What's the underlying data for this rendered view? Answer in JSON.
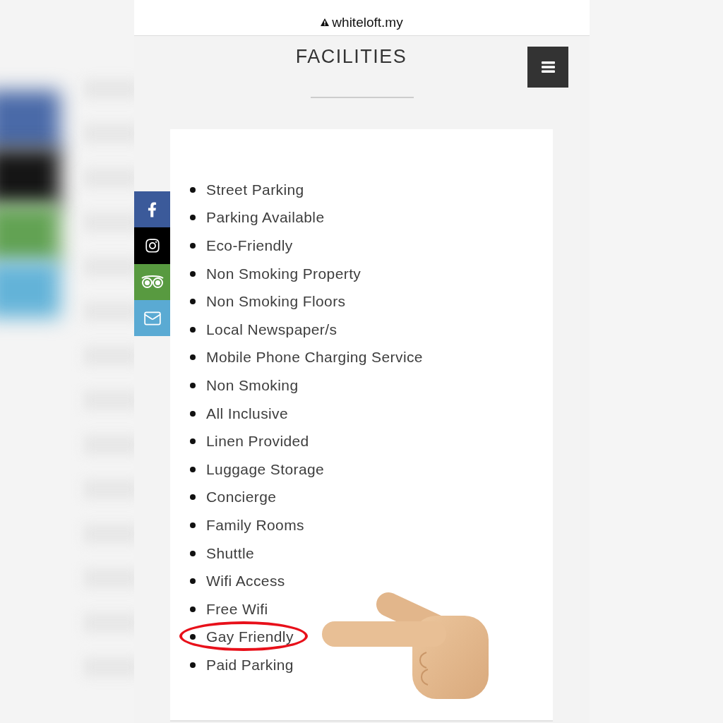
{
  "address_bar": {
    "insecure": true,
    "url": "whiteloft.my"
  },
  "page": {
    "title": "FACILITIES"
  },
  "social_links": [
    {
      "kind": "facebook",
      "color": "#3b5a9a"
    },
    {
      "kind": "instagram",
      "color": "#000000"
    },
    {
      "kind": "tripadvisor",
      "color": "#589a40"
    },
    {
      "kind": "email",
      "color": "#5aaad3"
    }
  ],
  "facilities": [
    {
      "label": "Street Parking",
      "highlighted": false
    },
    {
      "label": "Parking Available",
      "highlighted": false
    },
    {
      "label": "Eco-Friendly",
      "highlighted": false
    },
    {
      "label": "Non Smoking Property",
      "highlighted": false
    },
    {
      "label": "Non Smoking Floors",
      "highlighted": false
    },
    {
      "label": "Local Newspaper/s",
      "highlighted": false
    },
    {
      "label": "Mobile Phone Charging Service",
      "highlighted": false
    },
    {
      "label": "Non Smoking",
      "highlighted": false
    },
    {
      "label": "All Inclusive",
      "highlighted": false
    },
    {
      "label": "Linen Provided",
      "highlighted": false
    },
    {
      "label": "Luggage Storage",
      "highlighted": false
    },
    {
      "label": "Concierge",
      "highlighted": false
    },
    {
      "label": "Family Rooms",
      "highlighted": false
    },
    {
      "label": "Shuttle",
      "highlighted": false
    },
    {
      "label": "Wifi Access",
      "highlighted": false
    },
    {
      "label": "Free Wifi",
      "highlighted": false
    },
    {
      "label": "Gay Friendly",
      "highlighted": true
    },
    {
      "label": "Paid Parking",
      "highlighted": false
    }
  ]
}
